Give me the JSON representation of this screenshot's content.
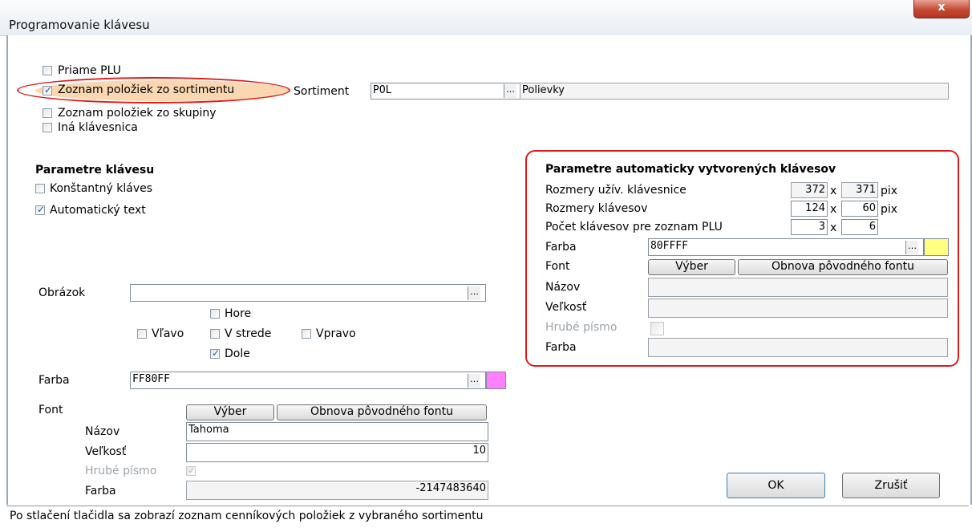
{
  "window": {
    "title": "Programovanie klávesu",
    "close_glyph": "x"
  },
  "source": {
    "priame_plu": {
      "label": "Priame PLU",
      "checked": false
    },
    "zoznam_sortiment": {
      "label": "Zoznam položiek zo sortimentu",
      "checked": true
    },
    "zoznam_skupiny": {
      "label": "Zoznam položiek zo skupiny",
      "checked": false
    },
    "ina_klavesnica": {
      "label": "Iná klávesnica",
      "checked": false
    },
    "sortiment_label": "Sortiment",
    "sortiment_code": "POL",
    "sortiment_name": "Polievky"
  },
  "params": {
    "heading": "Parametre klávesu",
    "konstantny": {
      "label": "Konštantný kláves",
      "checked": false
    },
    "auto_text": {
      "label": "Automatický text",
      "checked": true
    }
  },
  "image": {
    "label": "Obrázok",
    "value": "",
    "hore": "Hore",
    "vlavo": "Vľavo",
    "v_strede": "V strede",
    "vpravo": "Vpravo",
    "dole": "Dole",
    "dole_checked": true
  },
  "color": {
    "label": "Farba",
    "value": "FF80FF",
    "swatch": "#ff80ff"
  },
  "font": {
    "label": "Font",
    "vyber": "Výber",
    "obnova": "Obnova pôvodného fontu",
    "nazov_label": "Názov",
    "nazov": "Tahoma",
    "velkost_label": "Veľkosť",
    "velkost": "10",
    "hrube_label": "Hrubé písmo",
    "hrube_checked": true,
    "farba_label": "Farba",
    "farba": "-2147483640"
  },
  "auto": {
    "heading": "Parametre automaticky vytvorených klávesov",
    "rozmery_uziv_label": "Rozmery užív. klávesnice",
    "rozmery_uziv_w": "372",
    "rozmery_uziv_h": "371",
    "rozmery_klav_label": "Rozmery klávesov",
    "rozmery_klav_w": "124",
    "rozmery_klav_h": "60",
    "pocet_label": "Počet klávesov pre zoznam PLU",
    "pocet_x": "3",
    "pocet_y": "6",
    "x_sep": "x",
    "unit": "pix",
    "farba_label": "Farba",
    "farba": "80FFFF",
    "swatch": "#ffff80",
    "font_label": "Font",
    "vyber": "Výber",
    "obnova": "Obnova pôvodného fontu",
    "nazov_label": "Názov",
    "nazov": "",
    "velkost_label": "Veľkosť",
    "velkost": "",
    "hrube_label": "Hrubé písmo",
    "hrube_checked": false,
    "farba2_label": "Farba",
    "farba2": ""
  },
  "buttons": {
    "ok": "OK",
    "cancel": "Zrušiť"
  },
  "status": "Po stlačení tlačidla sa zobrazí zoznam cenníkových položiek z vybraného sortimentu"
}
